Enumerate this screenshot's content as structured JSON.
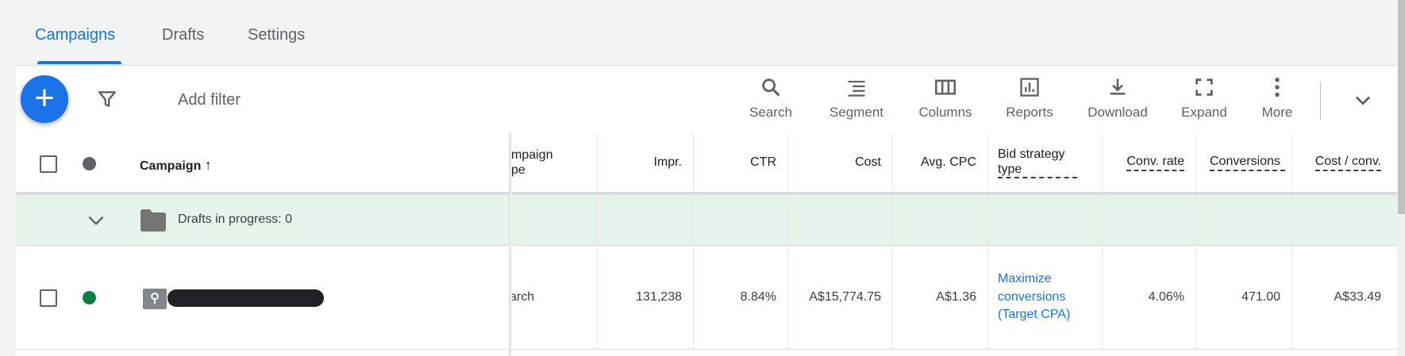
{
  "tabs": [
    {
      "label": "Campaigns",
      "active": true
    },
    {
      "label": "Drafts"
    },
    {
      "label": "Settings"
    }
  ],
  "toolbar": {
    "add_filter": "Add filter",
    "items": [
      {
        "label": "Search",
        "icon": "search-icon"
      },
      {
        "label": "Segment",
        "icon": "segment-icon"
      },
      {
        "label": "Columns",
        "icon": "columns-icon"
      },
      {
        "label": "Reports",
        "icon": "reports-icon"
      },
      {
        "label": "Download",
        "icon": "download-icon"
      },
      {
        "label": "Expand",
        "icon": "expand-icon"
      },
      {
        "label": "More",
        "icon": "more-icon"
      }
    ]
  },
  "table": {
    "headers": {
      "campaign": "Campaign",
      "campaign_type": "mpaign\npe",
      "impr": "Impr.",
      "ctr": "CTR",
      "cost": "Cost",
      "avg_cpc": "Avg. CPC",
      "bid_strategy": "Bid strategy type",
      "conv_rate": "Conv. rate",
      "conversions": "Conversions",
      "cost_conv": "Cost / conv."
    },
    "drafts_label": "Drafts in progress: 0",
    "rows": [
      {
        "status_color": "#0b8043",
        "campaign_type": "arch",
        "impr": "131,238",
        "ctr": "8.84%",
        "cost": "A$15,774.75",
        "avg_cpc": "A$1.36",
        "bid_strategy": "Maximize conversions (Target CPA)",
        "conv_rate": "4.06%",
        "conversions": "471.00",
        "cost_conv": "A$33.49"
      }
    ]
  },
  "colors": {
    "accent": "#1a73e8",
    "drafts_bg": "#e6f4ea"
  }
}
